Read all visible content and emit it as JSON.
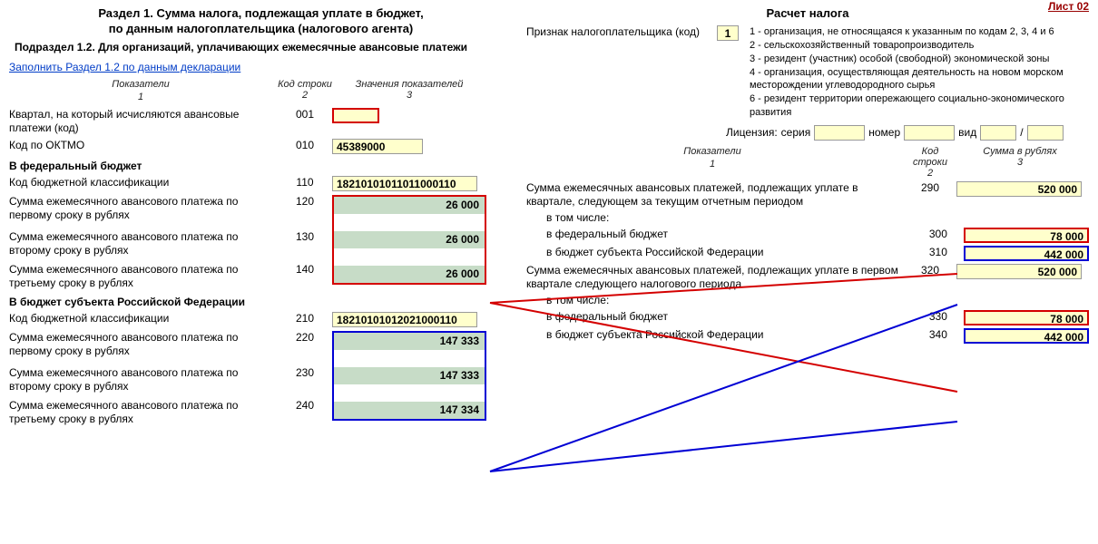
{
  "sheet_label": "Лист 02",
  "left": {
    "title1": "Раздел 1. Сумма налога, подлежащая уплате в бюджет,",
    "title2": "по данным налогоплательщика (налогового агента)",
    "subsection": "Подраздел 1.2. Для организаций, уплачивающих ежемесячные авансовые платежи",
    "fill_link": "Заполнить Раздел 1.2 по данным декларации",
    "col1": "Показатели",
    "col1n": "1",
    "col2": "Код строки",
    "col2n": "2",
    "col3": "Значения показателей",
    "col3n": "3",
    "rows": {
      "r001": {
        "label": "Квартал, на который исчисляются авансовые платежи (код)",
        "code": "001",
        "value": ""
      },
      "r010": {
        "label": "Код по ОКТМО",
        "code": "010",
        "value": "45389000"
      }
    },
    "fed_title": "В федеральный бюджет",
    "fed": {
      "r110": {
        "label": "Код бюджетной классификации",
        "code": "110",
        "value": "18210101011011000110"
      },
      "r120": {
        "label": "Сумма ежемесячного авансового платежа по первому сроку в рублях",
        "code": "120",
        "value": "26 000"
      },
      "r130": {
        "label": "Сумма ежемесячного авансового платежа по второму сроку в рублях",
        "code": "130",
        "value": "26 000"
      },
      "r140": {
        "label": "Сумма ежемесячного авансового платежа по третьему сроку в рублях",
        "code": "140",
        "value": "26 000"
      }
    },
    "sub_title": "В бюджет субъекта Российской Федерации",
    "subj": {
      "r210": {
        "label": "Код бюджетной классификации",
        "code": "210",
        "value": "18210101012021000110"
      },
      "r220": {
        "label": "Сумма ежемесячного авансового платежа по первому сроку в рублях",
        "code": "220",
        "value": "147 333"
      },
      "r230": {
        "label": "Сумма ежемесячного авансового платежа по второму сроку в рублях",
        "code": "230",
        "value": "147 333"
      },
      "r240": {
        "label": "Сумма ежемесячного авансового платежа по третьему сроку в рублях",
        "code": "240",
        "value": "147 334"
      }
    }
  },
  "right": {
    "title": "Расчет налога",
    "priz_label": "Признак налогоплательщика (код)",
    "priz_value": "1",
    "codes": [
      "1 - организация, не относящаяся к указанным по кодам 2, 3, 4 и 6",
      "2 - сельскохозяйственный товаропроизводитель",
      "3 - резидент (участник) особой (свободной) экономической зоны",
      "4 - организация, осуществляющая деятельность на новом морском месторождении углеводородного сырья",
      "6 - резидент территории опережающего социально-экономического развития"
    ],
    "lic": {
      "label": "Лицензия:",
      "serie": "серия",
      "num": "номер",
      "vid": "вид",
      "slash": "/"
    },
    "col1": "Показатели",
    "col1n": "1",
    "col2": "Код строки",
    "col2n": "2",
    "col3": "Сумма в рублях",
    "col3n": "3",
    "rows": {
      "r290": {
        "label": "Сумма ежемесячных авансовых платежей, подлежащих уплате в квартале, следующем за текущим отчетным периодом",
        "code": "290",
        "value": "520 000"
      },
      "incl": "в том числе:",
      "r300": {
        "label": "в федеральный бюджет",
        "code": "300",
        "value": "78 000"
      },
      "r310": {
        "label": "в бюджет субъекта Российской Федерации",
        "code": "310",
        "value": "442 000"
      },
      "r320": {
        "label": "Сумма ежемесячных авансовых платежей, подлежащих уплате в первом квартале следующего налогового периода",
        "code": "320",
        "value": "520 000"
      },
      "incl2": "в том числе:",
      "r330": {
        "label": "в федеральный бюджет",
        "code": "330",
        "value": "78 000"
      },
      "r340": {
        "label": "в бюджет субъекта Российской Федерации",
        "code": "340",
        "value": "442 000"
      }
    }
  }
}
